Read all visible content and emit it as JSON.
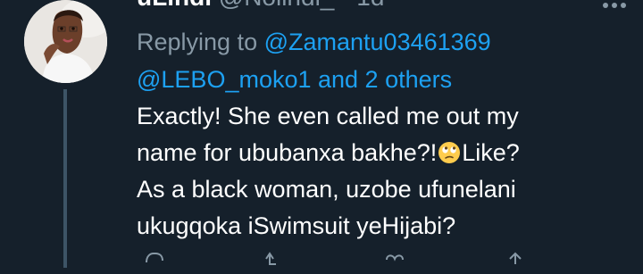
{
  "tweet": {
    "display_name": "uLindi",
    "handle": "@Nolindi_",
    "separator": " · ",
    "timestamp": "1d",
    "reply": {
      "prefix": "Replying to ",
      "mention_primary": "@Zamantu03461369",
      "mention_secondary": "@LEBO_moko1",
      "others": " and 2 others"
    },
    "text": {
      "line1": "Exactly! She even called me out my",
      "line2_before": "name for ububanxa bakhe?!",
      "line2_after": "Like?",
      "line3": "As a black woman, uzobe ufunelani",
      "line4": "ukugqoka iSwimsuit yeHijabi?"
    },
    "emoji": "face-with-rolling-eyes"
  },
  "colors": {
    "background": "#15202b",
    "text": "#ffffff",
    "muted": "#8899a6",
    "link": "#1da1f2",
    "thread_line": "#3d5466"
  },
  "icons": {
    "more": "more-horizontal-icon",
    "reply": "reply-icon",
    "retweet": "retweet-icon",
    "like": "like-icon",
    "share": "share-icon"
  }
}
